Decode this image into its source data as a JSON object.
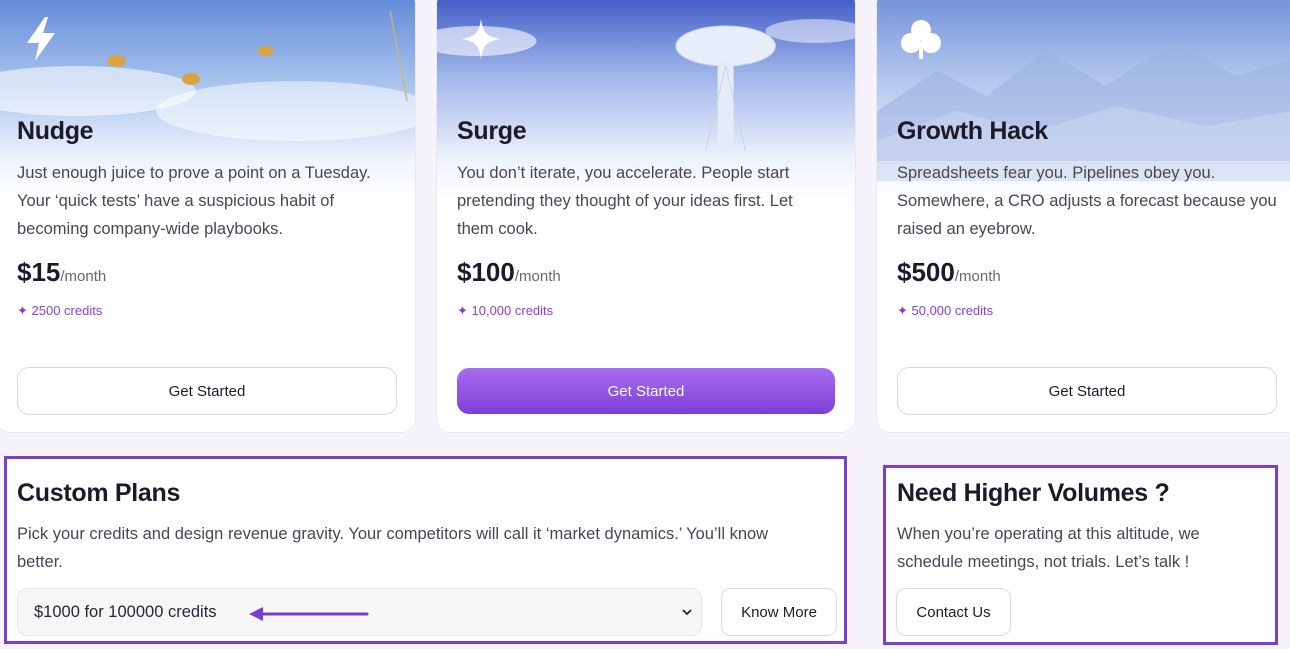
{
  "plans": [
    {
      "icon": "lightning-icon",
      "title": "Nudge",
      "description": "Just enough juice to prove a point on a Tuesday. Your ‘quick tests’ have a suspicious habit of becoming company-wide playbooks.",
      "price": "$15",
      "period": "/month",
      "credits": "✦ 2500 credits",
      "cta": "Get Started"
    },
    {
      "icon": "sparkle-icon",
      "title": "Surge",
      "description": "You don’t iterate, you accelerate. People start pretending they thought of your ideas first. Let them cook.",
      "price": "$100",
      "period": "/month",
      "credits": "✦ 10,000 credits",
      "cta": "Get Started"
    },
    {
      "icon": "clover-icon",
      "title": "Growth Hack",
      "description": "Spreadsheets fear you. Pipelines obey you. Somewhere, a CRO adjusts a forecast because you raised an eyebrow.",
      "price": "$500",
      "period": "/month",
      "credits": "✦ 50,000 credits",
      "cta": "Get Started"
    }
  ],
  "custom": {
    "title": "Custom Plans",
    "description": "Pick your credits and design revenue gravity. Your competitors will call it ‘market dynamics.’ You’ll know better.",
    "selected_option": "$1000 for 100000 credits",
    "cta": "Know More"
  },
  "volumes": {
    "title": "Need Higher Volumes ?",
    "description": "When you’re operating at this altitude, we schedule meetings, not trials. Let’s talk !",
    "cta": "Contact Us"
  },
  "colors": {
    "accent": "#7b3fcf",
    "primary_button_top": "#a86cf0",
    "primary_button_bottom": "#7d40d8",
    "credits_text": "#8a3fd6"
  }
}
